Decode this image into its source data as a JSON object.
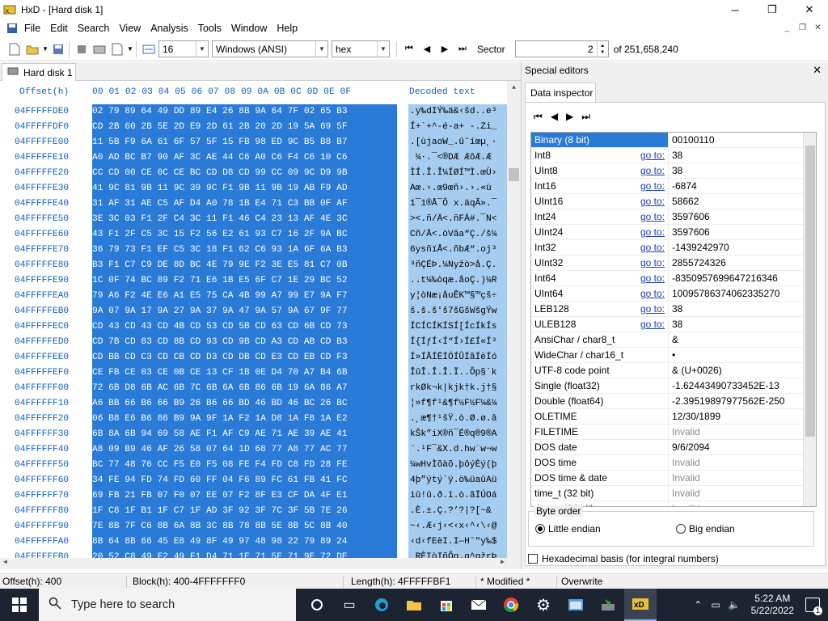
{
  "window": {
    "title": "HxD - [Hard disk 1]",
    "minimize": "─",
    "maximize": "❐",
    "close": "✕"
  },
  "menu": [
    "File",
    "Edit",
    "Search",
    "View",
    "Analysis",
    "Tools",
    "Window",
    "Help"
  ],
  "toolbar": {
    "bytes_per_row": "16",
    "charset": "Windows (ANSI)",
    "offset_base": "hex",
    "sector_label": "Sector",
    "sector_value": "2",
    "sector_total": "of 251,658,240"
  },
  "doc_tab": "Hard disk 1",
  "hex": {
    "header_offset": "Offset(h)",
    "header_cols": "00 01 02 03 04 05 06 07 08 09 0A 0B 0C 0D 0E 0F",
    "header_text": "Decoded text",
    "rows": [
      {
        "o": "04FFFFFDE0",
        "h": "02 79 89 64 49 DD 89 E4 26 8B 9A 64 7F 02 65 B3",
        "t": ".y‰dIÝ‰ä&‹šd..e³"
      },
      {
        "o": "04FFFFFDF0",
        "h": "CD 2B 60 2B 5E 2D E9 2D 61 2B 20 2D 19 5A 69 5F",
        "t": "Í+`+^-é-a+ -.Zi_"
      },
      {
        "o": "04FFFFFE00",
        "h": "11 5B F9 6A 61 6F 57 5F 15 FB 98 ED 9C B5 B8 B7",
        "t": ".[ùjaoW_.û˜íœµ¸·"
      },
      {
        "o": "04FFFFFE10",
        "h": "A0 AD BC B7 90 AF 3C AE 44 C6 A0 C6 F4 C6 10 C6",
        "t": " ­¼·.¯<®DÆ ÆôÆ.Æ"
      },
      {
        "o": "04FFFFFE20",
        "h": "CC CD 00 CE 0C CE BC CD D8 CD 99 CC 09 9C D9 9B",
        "t": "ÌÍ.Î.Î¼ÍØÍ™Ì.œÙ›"
      },
      {
        "o": "04FFFFFE30",
        "h": "41 9C 81 9B 11 9C 39 9C F1 9B 11 9B 19 AB F9 AD",
        "t": "Aœ.›.œ9œñ›.›.«ù­"
      },
      {
        "o": "04FFFFFE40",
        "h": "31 AF 31 AE C5 AF D4 A0 78 1B E4 71 C3 BB 0F AF",
        "t": "1¯1®Å¯Ô x.äqÃ».¯"
      },
      {
        "o": "04FFFFFE50",
        "h": "3E 3C 03 F1 2F C4 3C 11 F1 46 C4 23 13 AF 4E 3C",
        "t": "><.ñ/Ä<.ñFÄ#.¯N<"
      },
      {
        "o": "04FFFFFE60",
        "h": "43 F1 2F C5 3C 15 F2 56 E2 61 93 C7 16 2F 9A BC",
        "t": "Cñ/Å<.òVâa“Ç./š¼"
      },
      {
        "o": "04FFFFFE70",
        "h": "36 79 73 F1 EF C5 3C 18 F1 62 C6 93 1A 6F 6A B3",
        "t": "6ysñïÅ<.ñbÆ“.oj³"
      },
      {
        "o": "04FFFFFE80",
        "h": "B3 F1 C7 C9 DE 8D BC 4E 79 9E F2 3E E5 81 C7 0B",
        "t": "³ñÇÉÞ.¼Nyžò>å.Ç."
      },
      {
        "o": "04FFFFFE90",
        "h": "1C 0F 74 BC 89 F2 71 E6 1B E5 6F C7 1E 29 BC 52",
        "t": "..t¼‰òqæ.åoÇ.)¼R"
      },
      {
        "o": "04FFFFFEA0",
        "h": "79 A6 F2 4E E6 A1 E5 75 CA 4B 99 A7 99 E7 9A F7",
        "t": "y¦òNæ¡åuÊK™§™çš÷"
      },
      {
        "o": "04FFFFFEB0",
        "h": "9A 07 9A 17 9A 27 9A 37 9A 47 9A 57 9A 67 9F 77",
        "t": "š.š.š'š7šGšWšgŸw"
      },
      {
        "o": "04FFFFFEC0",
        "h": "CD 43 CD 43 CD 4B CD 53 CD 5B CD 63 CD 6B CD 73",
        "t": "ÍCÍCÍKÍSÍ[ÍcÍkÍs"
      },
      {
        "o": "04FFFFFED0",
        "h": "CD 7B CD 83 CD 8B CD 93 CD 9B CD A3 CD AB CD B3",
        "t": "Í{ÍƒÍ‹Í“Í›Í£Í«Í³"
      },
      {
        "o": "04FFFFFEE0",
        "h": "CD BB CD C3 CD CB CD D3 CD DB CD E3 CD EB CD F3",
        "t": "Í»ÍÃÍËÍÓÍÛÍãÍëÍó"
      },
      {
        "o": "04FFFFFEF0",
        "h": "CE FB CE 03 CE 0B CE 13 CF 1B 0E D4 70 A7 B4 6B",
        "t": "ÎûÎ.Î.Î.Ï..Ôp§´k"
      },
      {
        "o": "04FFFFFF00",
        "h": "72 6B D8 6B AC 6B 7C 6B 6A 6B 86 6B 19 6A 86 A7",
        "t": "rkØk¬k|kjk†k.j†§"
      },
      {
        "o": "04FFFFFF10",
        "h": "A6 BB 66 B6 66 B9 26 B6 66 BD 46 BD 46 BC 26 BC",
        "t": "¦»f¶f¹&¶f½F½F¼&¼"
      },
      {
        "o": "04FFFFFF20",
        "h": "06 B8 E6 B6 86 B9 9A 9F 1A F2 1A D8 1A F8 1A E2",
        "t": ".¸æ¶†¹šŸ.ò.Ø.ø.â"
      },
      {
        "o": "04FFFFFF30",
        "h": "6B 8A 6B 94 69 58 AE F1 AF C9 AE 71 AE 39 AE 41",
        "t": "kŠk”iX®ñ¯É®q®9®A"
      },
      {
        "o": "04FFFFFF40",
        "h": "A8 09 B9 46 AF 26 58 07 64 1D 68 77 A8 77 AC 77",
        "t": "¨.¹F¯&X.d.hw¨w¬w"
      },
      {
        "o": "04FFFFFF50",
        "h": "BC 77 48 76 CC F5 E0 F5 08 FE F4 FD C8 FD 28 FE",
        "t": "¼wHvÌõàõ.þôýÈý(þ"
      },
      {
        "o": "04FFFFFF60",
        "h": "34 FE 94 FD 74 FD 60 FF 04 F6 89 FC 61 FB 41 FC",
        "t": "4þ”ýtý`ÿ.ö‰üaûAü"
      },
      {
        "o": "04FFFFFF70",
        "h": "69 FB 21 FB 07 F0 07 EE 07 F2 8F E3 CF DA 4F E1",
        "t": "iû!û.ð.î.ò.ãÏÚOá"
      },
      {
        "o": "04FFFFFF80",
        "h": "1F C8 1F B1 1F C7 1F AD 3F 92 3F 7C 3F 5B 7E 26",
        "t": ".È.±.Ç.­?’?|?[~&"
      },
      {
        "o": "04FFFFFF90",
        "h": "7E 8B 7F C6 8B 6A 8B 3C 8B 78 8B 5E 8B 5C 8B 40",
        "t": "~‹.Æ‹j‹<‹x‹^‹\\‹@"
      },
      {
        "o": "04FFFFFFA0",
        "h": "8B 64 8B 66 45 E8 49 8F 49 97 48 98 22 79 89 24",
        "t": "‹d‹fEèI.I—H˜\"y‰$"
      },
      {
        "o": "04FFFFFFB0",
        "h": "20 52 C8 49 F2 49 F1 D4 71 1E 71 5E 71 9E 72 DE",
        "t": " RÈIòIñÔq.q^qžrÞ"
      },
      {
        "o": "04FFFFFFC0",
        "h": "72 1E 72 5E 72 9E 73 DE 73 1E 73 5E 73 9E 74 DE",
        "t": "r.r^ržsÞs.s^sžtÞ"
      },
      {
        "o": "04FFFFFFD0",
        "h": "74 1E 74 5E 74 9E 75 DE 75 1E 75 5E 75 9E 76 DE",
        "t": "t.t^tžuÞu.u^užvÞ"
      },
      {
        "o": "04FFFFFFE0",
        "h": "76 1E 76 5E 76 9E 77 DE 77 1E 77 5E 77 9E 78 DE",
        "t": "v.v^vžwÞw.w^wžxÞ"
      },
      {
        "o": "04FFFFFFF0",
        "h": "78 1E 7D 5E 5E 8F 78 3E E4 FD 90 07 42 5E 0D 79",
        "t": "x.}^^.x>äý..B^.y"
      },
      {
        "o": "0500000000",
        "h": "47 E4 5E 91 9E 78 DE 78 1E 79 5E 79 9E 79 DE 79",
        "t": "Gä^‘žxÞx.y^yžyÞy"
      }
    ]
  },
  "special_editors": {
    "title": "Special editors",
    "tab": "Data inspector",
    "rows": [
      {
        "n": "Binary (8 bit)",
        "g": "",
        "v": "00100110",
        "inv": false
      },
      {
        "n": "Int8",
        "g": "go to:",
        "v": "38",
        "inv": false
      },
      {
        "n": "UInt8",
        "g": "go to:",
        "v": "38",
        "inv": false
      },
      {
        "n": "Int16",
        "g": "go to:",
        "v": "-6874",
        "inv": false
      },
      {
        "n": "UInt16",
        "g": "go to:",
        "v": "58662",
        "inv": false
      },
      {
        "n": "Int24",
        "g": "go to:",
        "v": "3597606",
        "inv": false
      },
      {
        "n": "UInt24",
        "g": "go to:",
        "v": "3597606",
        "inv": false
      },
      {
        "n": "Int32",
        "g": "go to:",
        "v": "-1439242970",
        "inv": false
      },
      {
        "n": "UInt32",
        "g": "go to:",
        "v": "2855724326",
        "inv": false
      },
      {
        "n": "Int64",
        "g": "go to:",
        "v": "-8350957699647216346",
        "inv": false
      },
      {
        "n": "UInt64",
        "g": "go to:",
        "v": "10095786374062335270",
        "inv": false
      },
      {
        "n": "LEB128",
        "g": "go to:",
        "v": "38",
        "inv": false
      },
      {
        "n": "ULEB128",
        "g": "go to:",
        "v": "38",
        "inv": false
      },
      {
        "n": "AnsiChar / char8_t",
        "g": "",
        "v": "&",
        "inv": false
      },
      {
        "n": "WideChar / char16_t",
        "g": "",
        "v": "•",
        "inv": false
      },
      {
        "n": "UTF-8 code point",
        "g": "",
        "v": "& (U+0026)",
        "inv": false
      },
      {
        "n": "Single (float32)",
        "g": "",
        "v": "-1.62443490733452E-13",
        "inv": false
      },
      {
        "n": "Double (float64)",
        "g": "",
        "v": "-2.39519897977562E-250",
        "inv": false
      },
      {
        "n": "OLETIME",
        "g": "",
        "v": "12/30/1899",
        "inv": false
      },
      {
        "n": "FILETIME",
        "g": "",
        "v": "Invalid",
        "inv": true
      },
      {
        "n": "DOS date",
        "g": "",
        "v": "9/6/2094",
        "inv": false
      },
      {
        "n": "DOS time",
        "g": "",
        "v": "Invalid",
        "inv": true
      },
      {
        "n": "DOS time & date",
        "g": "",
        "v": "Invalid",
        "inv": true
      },
      {
        "n": "time_t (32 bit)",
        "g": "",
        "v": "Invalid",
        "inv": true
      },
      {
        "n": "time_t (64 bit)",
        "g": "",
        "v": "Invalid",
        "inv": true
      }
    ],
    "byte_order": "Byte order",
    "little_endian": "Little endian",
    "big_endian": "Big endian",
    "hex_basis": "Hexadecimal basis (for integral numbers)"
  },
  "status": {
    "offset": "Offset(h): 400",
    "block": "Block(h): 400-4FFFFFFF0",
    "length": "Length(h): 4FFFFFBF1",
    "modified": "* Modified *",
    "mode": "Overwrite"
  },
  "taskbar": {
    "search_placeholder": "Type here to search",
    "time": "5:22 AM",
    "date": "5/22/2022",
    "notif_count": "1"
  }
}
